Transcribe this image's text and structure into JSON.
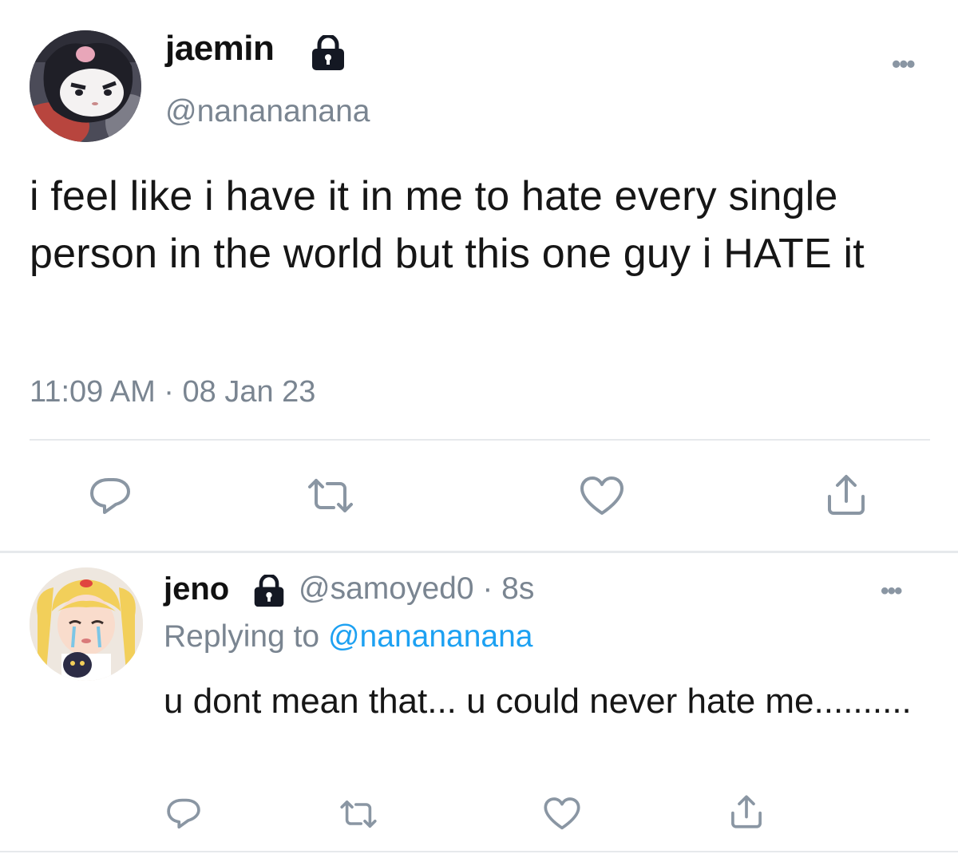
{
  "tweet": {
    "display_name": "jaemin",
    "handle": "@nanananana",
    "text": "i feel like i have it in me to hate every single person in the world but this one guy i HATE it",
    "timestamp": "11:09 AM · 08 Jan 23",
    "more_label": "•••",
    "icons": {
      "lock": "lock-icon",
      "reply": "reply-icon",
      "retweet": "retweet-icon",
      "like": "heart-icon",
      "share": "share-icon"
    }
  },
  "reply": {
    "display_name": "jeno",
    "handle_time": "@samoyed0 · 8s",
    "replying_prefix": "Replying to",
    "replying_mention": "@nanananana",
    "text": "u dont mean that... u could never hate me..........",
    "more_label": "•••"
  },
  "colors": {
    "text": "#161616",
    "secondary": "#7a8591",
    "mention": "#1da1f2",
    "divider": "#e6e9ec",
    "icon": "#8a96a3"
  }
}
